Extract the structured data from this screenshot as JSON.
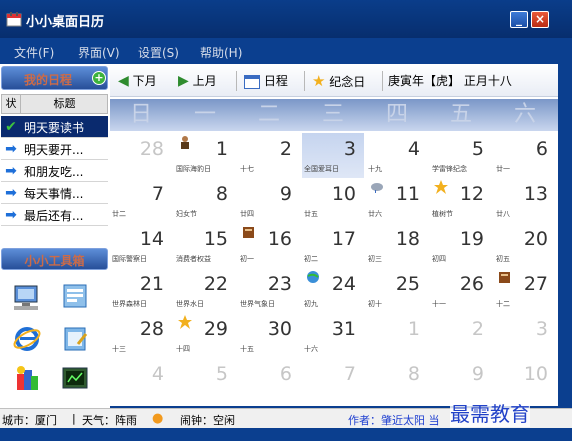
{
  "window": {
    "title": "小小桌面日历",
    "minimize": "_",
    "close": "×"
  },
  "menu": [
    {
      "label": "文件(F)",
      "left": 0
    },
    {
      "label": "界面(V)"
    },
    {
      "label": "设置(S)"
    },
    {
      "label": "帮助(H)"
    }
  ],
  "sidebar": {
    "schedule_title": "我的日程",
    "add_label": "+",
    "col_status": "状",
    "col_title": "标题",
    "items": [
      {
        "icon": "check-icon",
        "label": "明天要读书"
      },
      {
        "icon": "arrow-right-icon",
        "label": "明天要开..."
      },
      {
        "icon": "arrow-right-icon",
        "label": "和朋友吃..."
      },
      {
        "icon": "arrow-right-icon",
        "label": "每天事情..."
      },
      {
        "icon": "arrow-right-icon",
        "label": "最后还有..."
      }
    ],
    "tools_title": "小小工具箱",
    "tools": [
      "computer-icon",
      "network-icon",
      "ie-browser-icon",
      "notepad-icon",
      "paint-icon",
      "terminal-icon"
    ]
  },
  "toolbar": {
    "next_month": "下月",
    "prev_month": "上月",
    "schedule": "日程",
    "memorial": "纪念日",
    "lunar_date": "庚寅年【虎】 正月十八"
  },
  "calendar": {
    "weekdays": [
      "日",
      "一",
      "二",
      "三",
      "四",
      "五",
      "六"
    ],
    "weeks": [
      [
        {
          "d": "28",
          "l": "",
          "o": true
        },
        {
          "d": "1",
          "l": "国际海豹日",
          "m": "person"
        },
        {
          "d": "2",
          "l": "十七"
        },
        {
          "d": "3",
          "l": "全国爱耳日",
          "today": true
        },
        {
          "d": "4",
          "l": "十九"
        },
        {
          "d": "5",
          "l": "学雷锋纪念"
        },
        {
          "d": "6",
          "l": "廿一"
        }
      ],
      [
        {
          "d": "7",
          "l": "廿二"
        },
        {
          "d": "8",
          "l": "妇女节"
        },
        {
          "d": "9",
          "l": "廿四"
        },
        {
          "d": "10",
          "l": "廿五"
        },
        {
          "d": "11",
          "l": "廿六",
          "m": "cloud"
        },
        {
          "d": "12",
          "l": "植树节",
          "m": "star"
        },
        {
          "d": "13",
          "l": "廿八"
        }
      ],
      [
        {
          "d": "14",
          "l": "国际警察日"
        },
        {
          "d": "15",
          "l": "消费者权益"
        },
        {
          "d": "16",
          "l": "初一",
          "m": "book"
        },
        {
          "d": "17",
          "l": "初二"
        },
        {
          "d": "18",
          "l": "初三"
        },
        {
          "d": "19",
          "l": "初四"
        },
        {
          "d": "20",
          "l": "初五"
        }
      ],
      [
        {
          "d": "21",
          "l": "世界森林日"
        },
        {
          "d": "22",
          "l": "世界水日"
        },
        {
          "d": "23",
          "l": "世界气象日"
        },
        {
          "d": "24",
          "l": "初九",
          "m": "globe"
        },
        {
          "d": "25",
          "l": "初十"
        },
        {
          "d": "26",
          "l": "十一"
        },
        {
          "d": "27",
          "l": "十二",
          "m": "book"
        }
      ],
      [
        {
          "d": "28",
          "l": "十三"
        },
        {
          "d": "29",
          "l": "十四",
          "m": "star"
        },
        {
          "d": "30",
          "l": "十五"
        },
        {
          "d": "31",
          "l": "十六"
        },
        {
          "d": "1",
          "l": "",
          "o": true
        },
        {
          "d": "2",
          "l": "",
          "o": true
        },
        {
          "d": "3",
          "l": "",
          "o": true
        }
      ],
      [
        {
          "d": "4",
          "l": "",
          "o": true
        },
        {
          "d": "5",
          "l": "",
          "o": true
        },
        {
          "d": "6",
          "l": "",
          "o": true
        },
        {
          "d": "7",
          "l": "",
          "o": true
        },
        {
          "d": "8",
          "l": "",
          "o": true
        },
        {
          "d": "9",
          "l": "",
          "o": true
        },
        {
          "d": "10",
          "l": "",
          "o": true
        }
      ]
    ]
  },
  "status": {
    "city": "城市：厦门",
    "divider": "|",
    "weather": "天气：阵雨",
    "alarm": "闹钟：空闲",
    "author": "作者：肇近太阳 当"
  },
  "watermark": "最需教育",
  "colors": {
    "title_bg": "#0b3f8f",
    "selected_row": "#0a2a6e",
    "header_text": "#cc6b48",
    "today_bg": "#c5d4ef",
    "author_text": "#1f3fd0"
  }
}
